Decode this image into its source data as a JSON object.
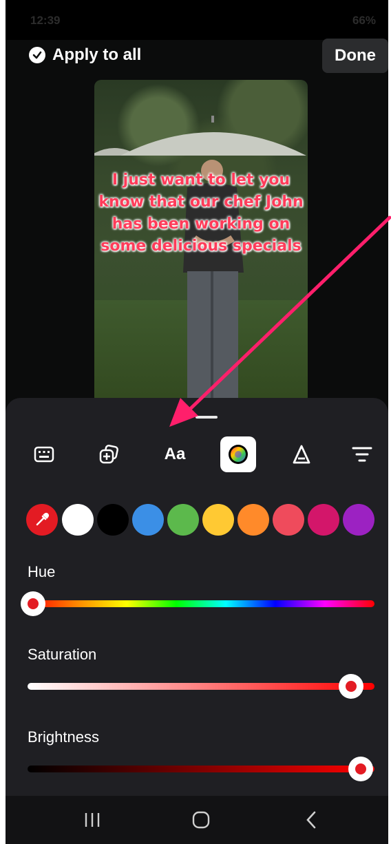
{
  "status_bar": {
    "time": "12:39",
    "battery": "66%"
  },
  "top_bar": {
    "apply_all_label": "Apply to all",
    "done_label": "Done"
  },
  "preview": {
    "caption": "I just want to let you know that our chef John has been working on some delicious specials"
  },
  "toolbar": {
    "tools": [
      {
        "icon": "keyboard-icon"
      },
      {
        "icon": "sticker-add-icon"
      },
      {
        "label": "Aa",
        "icon": "font-icon"
      },
      {
        "icon": "color-wheel-icon",
        "active": true
      },
      {
        "icon": "text-style-icon"
      },
      {
        "icon": "align-icon"
      }
    ]
  },
  "colors": {
    "picker_icon": "eyedropper-icon",
    "swatches": [
      "#e31b23",
      "#ffffff",
      "#000000",
      "#3b8fe6",
      "#5cb94c",
      "#ffc933",
      "#ff8a2a",
      "#ef4b5c",
      "#d3166a",
      "#9c22c2"
    ]
  },
  "sliders": {
    "hue": {
      "label": "Hue",
      "value": 0
    },
    "saturation": {
      "label": "Saturation",
      "value": 0.94
    },
    "brightness": {
      "label": "Brightness",
      "value": 0.96
    }
  },
  "accent_color": "#e31b23",
  "annotation_arrow_color": "#ff1f6b"
}
